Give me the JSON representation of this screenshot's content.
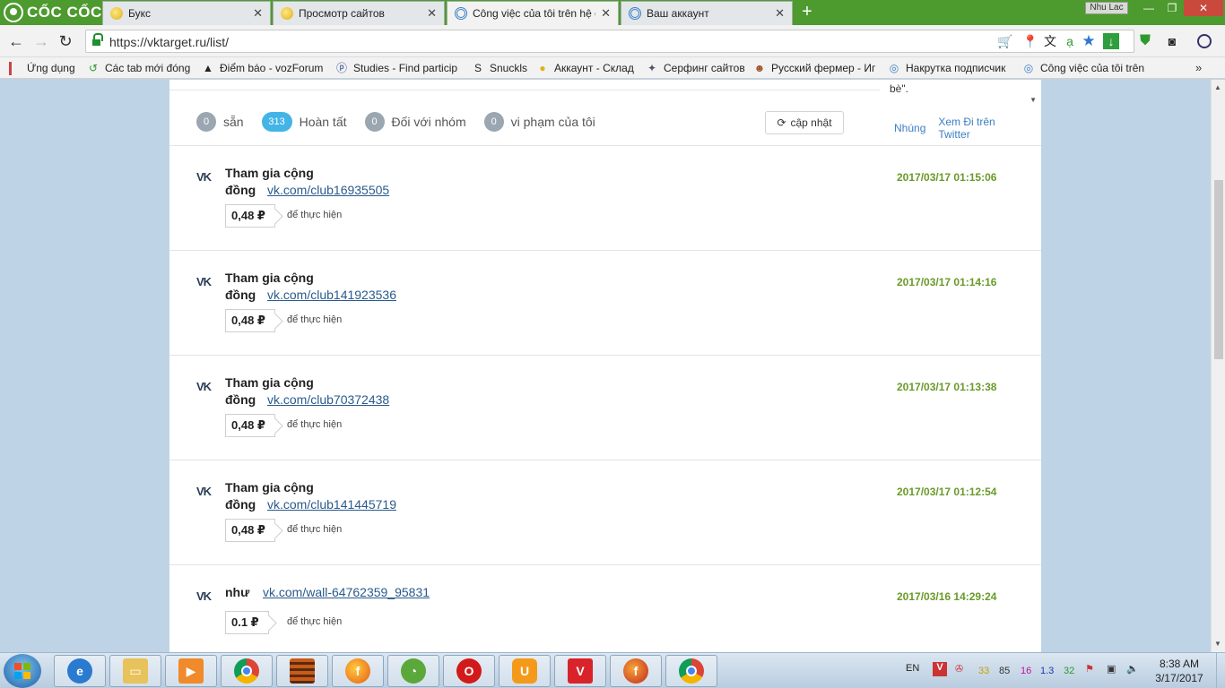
{
  "browser": {
    "brand": "CỐC CỐC",
    "tabs": [
      {
        "title": "Букс",
        "active": false
      },
      {
        "title": "Просмотр сайтов",
        "active": false
      },
      {
        "title": "Công việc của tôi trên hệ g",
        "active": true
      },
      {
        "title": "Ваш аккаунт",
        "active": false
      }
    ],
    "profile": "Nhu Lac",
    "url": "https://vktarget.ru/list/"
  },
  "bookmarks": [
    {
      "label": "Ứng dụng",
      "icon": "apps-grid-icon"
    },
    {
      "label": "Các tab mới đóng",
      "icon": "history-icon"
    },
    {
      "label": "Điểm báo - vozForum",
      "icon": "voz-icon"
    },
    {
      "label": "Studies - Find particip",
      "icon": "prolific-icon"
    },
    {
      "label": "Snuckls",
      "icon": "snuckls-icon"
    },
    {
      "label": "Аккаунт - Склад",
      "icon": "coin-icon"
    },
    {
      "label": "Серфинг сайтов",
      "icon": "surf-icon"
    },
    {
      "label": "Русский фермер - Иг",
      "icon": "farmer-icon"
    },
    {
      "label": "Накрутка подписчик",
      "icon": "vktarget-icon"
    },
    {
      "label": "Công việc của tôi trên",
      "icon": "vktarget-icon"
    }
  ],
  "filters": [
    {
      "count": "0",
      "label": "sẵn"
    },
    {
      "count": "313",
      "label": "Hoàn tất"
    },
    {
      "count": "0",
      "label": "Đối với nhóm"
    },
    {
      "count": "0",
      "label": "vi phạm của tôi"
    }
  ],
  "update_label": "cập nhật",
  "sidebar": {
    "text": "bè\".",
    "embed_label": "Nhúng",
    "twitter_label": "Xem Đi trên Twitter"
  },
  "tasks": [
    {
      "title_line1": "Tham gia cộng",
      "title_line2": "đồng",
      "link": "vk.com/club16935505",
      "price": "0,48 ₽",
      "action": "để thực hiện",
      "date": "2017/03/17 01:15:06"
    },
    {
      "title_line1": "Tham gia cộng",
      "title_line2": "đồng",
      "link": "vk.com/club141923536",
      "price": "0,48 ₽",
      "action": "để thực hiện",
      "date": "2017/03/17 01:14:16"
    },
    {
      "title_line1": "Tham gia cộng",
      "title_line2": "đồng",
      "link": "vk.com/club70372438",
      "price": "0,48 ₽",
      "action": "để thực hiện",
      "date": "2017/03/17 01:13:38"
    },
    {
      "title_line1": "Tham gia cộng",
      "title_line2": "đồng",
      "link": "vk.com/club141445719",
      "price": "0,48 ₽",
      "action": "để thực hiện",
      "date": "2017/03/17 01:12:54"
    },
    {
      "title_line1": "như",
      "title_line2": "",
      "link": "vk.com/wall-64762359_95831",
      "price": "0.1 ₽",
      "action": "để thực hiện",
      "date": "2017/03/16 14:29:24"
    }
  ],
  "taskbar": {
    "language": "EN",
    "tray_numbers": [
      "33",
      "85",
      "16",
      "1.3",
      "32"
    ],
    "time": "8:38 AM",
    "date": "3/17/2017"
  },
  "colors": {
    "accent_badge": "#43b4e6",
    "date_green": "#6a9a2a",
    "link_blue": "#2a5a8c",
    "tabstrip_green": "#4d9a2f"
  }
}
